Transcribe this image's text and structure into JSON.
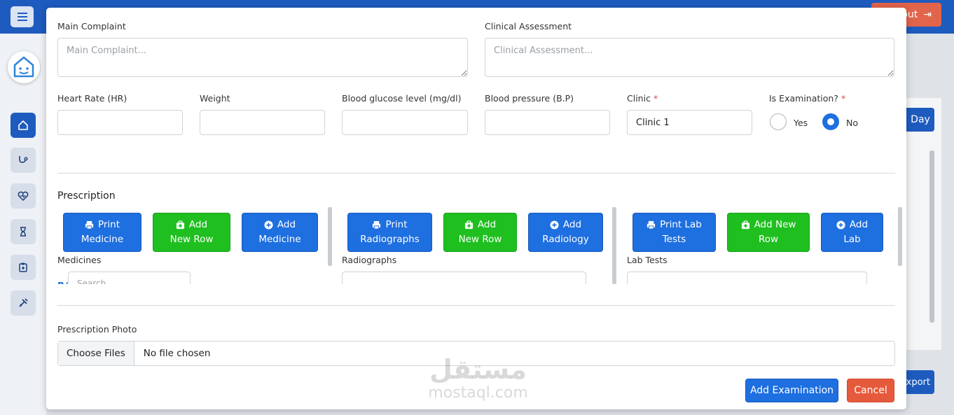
{
  "app": {
    "logout_label": "Logout",
    "day_label": "Day",
    "export_label": "Export"
  },
  "form": {
    "main_complaint": {
      "label": "Main Complaint",
      "placeholder": "Main Complaint..."
    },
    "clinical_assessment": {
      "label": "Clinical Assessment",
      "placeholder": "Clinical Assessment..."
    },
    "heart_rate": {
      "label": "Heart Rate (HR)",
      "value": ""
    },
    "weight": {
      "label": "Weight",
      "value": ""
    },
    "blood_glucose": {
      "label": "Blood glucose level (mg/dl)",
      "value": ""
    },
    "blood_pressure": {
      "label": "Blood pressure (B.P)",
      "value": ""
    },
    "clinic": {
      "label": "Clinic",
      "required_mark": "*",
      "value": "Clinic 1"
    },
    "is_examination": {
      "label": "Is Examination?",
      "required_mark": "*",
      "options": [
        "Yes",
        "No"
      ],
      "selected": "No"
    }
  },
  "prescription": {
    "title": "Prescription",
    "medicines": {
      "label": "Medicines",
      "print_label": [
        "Print",
        "Medicine"
      ],
      "add_row_label": [
        "Add",
        "New Row"
      ],
      "add_label": [
        "Add",
        "Medicine"
      ],
      "search_placeholder": "Search..."
    },
    "radiographs": {
      "label": "Radiographs",
      "print_label": [
        "Print",
        "Radiographs"
      ],
      "add_row_label": [
        "Add",
        "New Row"
      ],
      "add_label": [
        "Add",
        "Radiology"
      ]
    },
    "lab_tests": {
      "label": "Lab Tests",
      "print_label": [
        "Print Lab",
        "Tests"
      ],
      "add_row_label": [
        "Add New",
        "Row"
      ],
      "add_label": [
        "Add",
        "Lab"
      ]
    }
  },
  "photo": {
    "label": "Prescription Photo",
    "choose_label": "Choose Files",
    "status": "No file chosen"
  },
  "footer": {
    "submit_label": "Add Examination",
    "cancel_label": "Cancel"
  },
  "watermark": {
    "arabic": "مستقل",
    "latin": "mostaql.com"
  },
  "colors": {
    "primary": "#1e6fe0",
    "success": "#1fbf1f",
    "danger": "#e55a3c",
    "header": "#1e5bbf"
  }
}
